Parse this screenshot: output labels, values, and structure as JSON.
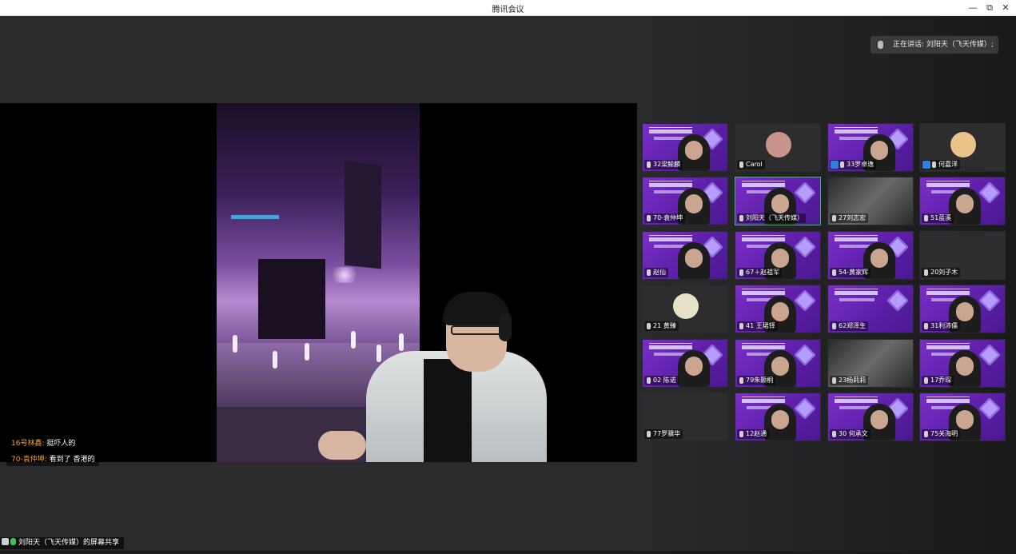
{
  "window": {
    "title": "腾讯会议",
    "minimize": "—",
    "restore": "⧉",
    "close": "✕"
  },
  "chat": [
    {
      "name": "16号林鑫:",
      "text": "挺吓人的"
    },
    {
      "name": "70-袁仲坤:",
      "text": "看到了 香港的"
    }
  ],
  "share_label": "刘阳天（飞天传媒）的屏幕共享",
  "speaking": "正在讲话: 刘阳天（飞天传媒）;",
  "participants": [
    {
      "name": "32梁鲸麟",
      "style": "purple"
    },
    {
      "name": "Carol",
      "style": "dark"
    },
    {
      "name": "33罗卓逸",
      "style": "purple"
    },
    {
      "name": "何嘉洋",
      "style": "dark"
    },
    {
      "name": "70-袁仲坤",
      "style": "purple"
    },
    {
      "name": "刘阳天（飞天传媒）",
      "style": "purple"
    },
    {
      "name": "27刘志宏",
      "style": "photo"
    },
    {
      "name": "51蓝溪",
      "style": "purple"
    },
    {
      "name": "赵仙",
      "style": "purple"
    },
    {
      "name": "67＋赵祖军",
      "style": "purple"
    },
    {
      "name": "54-黄家辉",
      "style": "purple"
    },
    {
      "name": "20刘子木",
      "style": "dark"
    },
    {
      "name": "21 黄臻",
      "style": "dark"
    },
    {
      "name": "41 王珺铎",
      "style": "purple"
    },
    {
      "name": "62郑泽生",
      "style": "purple"
    },
    {
      "name": "31利沛儒",
      "style": "purple"
    },
    {
      "name": "02 陈诺",
      "style": "purple"
    },
    {
      "name": "79朱颢桐",
      "style": "purple"
    },
    {
      "name": "23杨莉莉",
      "style": "photo"
    },
    {
      "name": "17乔琛",
      "style": "purple"
    },
    {
      "name": "77罗骥华",
      "style": "dark"
    },
    {
      "name": "12赵通",
      "style": "purple"
    },
    {
      "name": "30 何承文",
      "style": "purple"
    },
    {
      "name": "75关海明",
      "style": "purple"
    }
  ],
  "colors": {
    "accent_active": "#36c35a",
    "chat_name": "#f0a33a",
    "tile_purple": "#7a2ec8"
  }
}
